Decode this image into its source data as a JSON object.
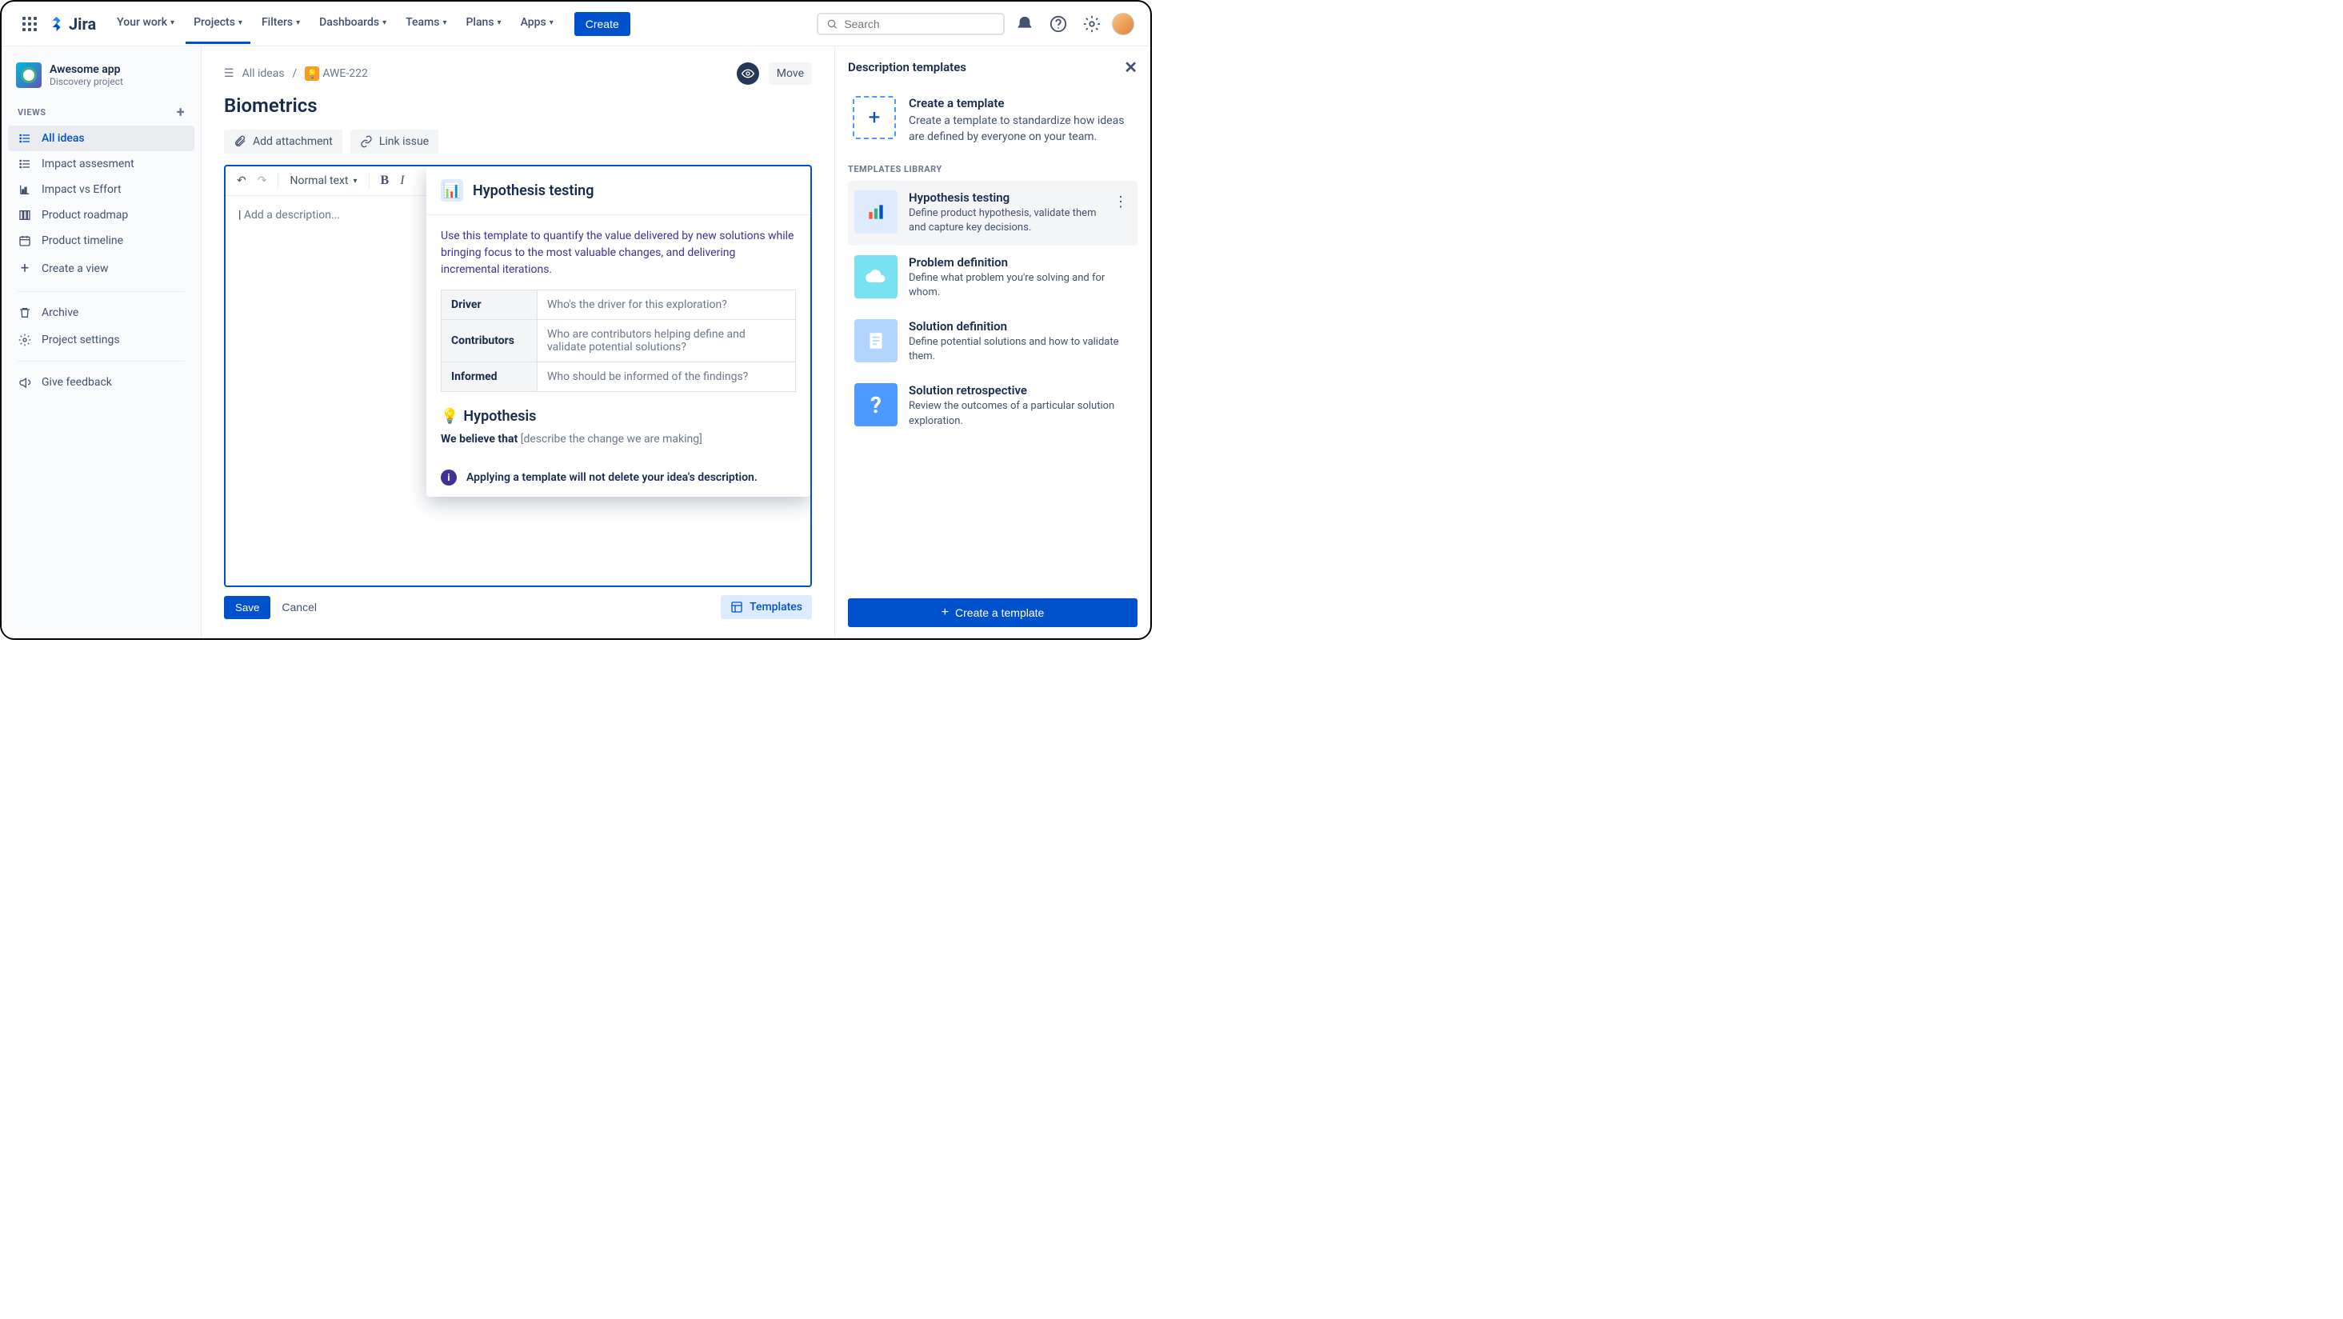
{
  "nav": {
    "product": "Jira",
    "items": [
      "Your work",
      "Projects",
      "Filters",
      "Dashboards",
      "Teams",
      "Plans",
      "Apps"
    ],
    "active_index": 1,
    "create": "Create",
    "search_placeholder": "Search"
  },
  "sidebar": {
    "project_name": "Awesome app",
    "project_type": "Discovery project",
    "views_label": "VIEWS",
    "items": [
      {
        "label": "All ideas",
        "icon": "list"
      },
      {
        "label": "Impact assesment",
        "icon": "list"
      },
      {
        "label": "Impact vs Effort",
        "icon": "chart"
      },
      {
        "label": "Product roadmap",
        "icon": "board"
      },
      {
        "label": "Product timeline",
        "icon": "calendar"
      },
      {
        "label": "Create a view",
        "icon": "plus"
      }
    ],
    "selected_index": 0,
    "archive": "Archive",
    "settings": "Project settings",
    "feedback": "Give feedback"
  },
  "main": {
    "breadcrumb_all": "All ideas",
    "issue_key": "AWE-222",
    "move": "Move",
    "title": "Biometrics",
    "add_attachment": "Add attachment",
    "link_issue": "Link issue",
    "text_style": "Normal text",
    "desc_placeholder": "Add a description...",
    "save": "Save",
    "cancel": "Cancel",
    "templates": "Templates"
  },
  "popover": {
    "title": "Hypothesis testing",
    "intro": "Use this template to quantify the value delivered by new solutions while bringing focus to the most valuable changes, and delivering incremental iterations.",
    "rows": [
      {
        "label": "Driver",
        "hint": "Who's the driver for this exploration?"
      },
      {
        "label": "Contributors",
        "hint": "Who are contributors helping define and validate potential solutions?"
      },
      {
        "label": "Informed",
        "hint": "Who should be informed of the findings?"
      }
    ],
    "hypo_heading": "Hypothesis",
    "believe_label": "We believe that",
    "believe_hint": "[describe the change we are making]",
    "info": "Applying a template will not delete your idea's description."
  },
  "rpanel": {
    "title": "Description templates",
    "create_title": "Create a template",
    "create_desc": "Create a template to standardize how ideas are defined by everyone on your team.",
    "library_label": "TEMPLATES LIBRARY",
    "templates": [
      {
        "title": "Hypothesis testing",
        "desc": "Define product hypothesis, validate them and capture key decisions.",
        "color": "#DEEBFF",
        "glyph": "chart"
      },
      {
        "title": "Problem definition",
        "desc": "Define what problem you're solving and for whom.",
        "color": "#79E2F2",
        "glyph": "cloud"
      },
      {
        "title": "Solution definition",
        "desc": "Define potential solutions and how to validate them.",
        "color": "#B3D4FF",
        "glyph": "note"
      },
      {
        "title": "Solution retrospective",
        "desc": "Review the outcomes of a particular solution exploration.",
        "color": "#4C9AFF",
        "glyph": "question"
      }
    ],
    "selected_index": 0,
    "create_button": "Create a template"
  }
}
